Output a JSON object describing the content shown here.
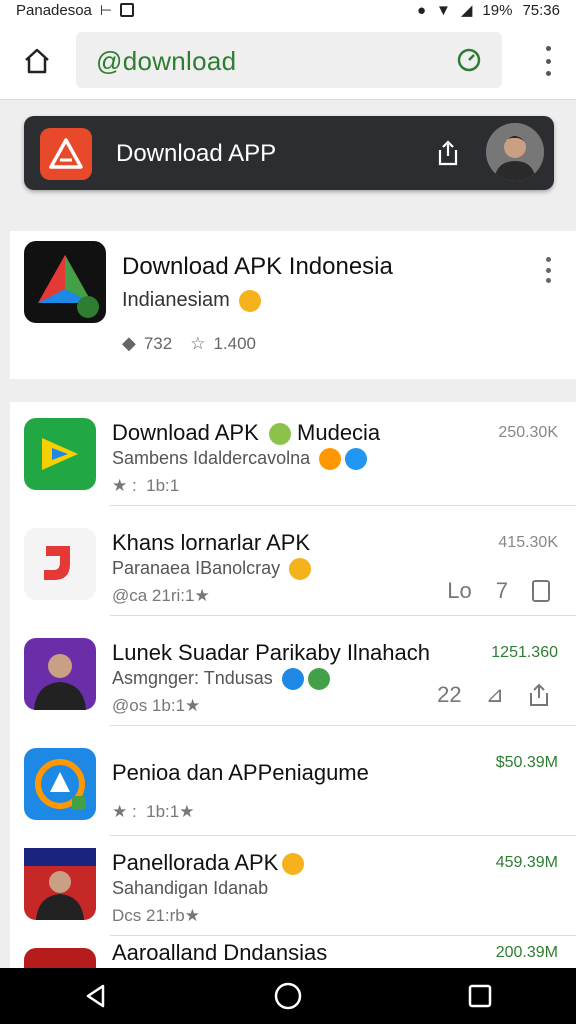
{
  "status_bar": {
    "left_text": "Panadesoa",
    "left_icons": [
      "hash-icon",
      "sim-icon"
    ],
    "battery": "19%",
    "time": "75:36"
  },
  "url_bar": {
    "url": "@download"
  },
  "app_bar": {
    "title": "Download APP"
  },
  "featured": {
    "title": "Download APK Indonesia",
    "subtitle": "Indianesiam",
    "tags_count": "732",
    "rating": "1.400"
  },
  "list": [
    {
      "title": "Download APK",
      "title_suffix": "Mudecia",
      "subtitle": "Sambens Idaldercavolna",
      "meta": "★ :  1b:1",
      "size": "250.30K",
      "size_color": "#888888",
      "actions": []
    },
    {
      "title": "Khans lornarlar APK",
      "subtitle": "Paranaea IBanolcray",
      "meta": "@ca 21ri:1★",
      "size": "415.30K",
      "size_color": "#888888",
      "actions": [
        "Lo",
        "7"
      ]
    },
    {
      "title": "Lunek Suadar Parikaby Ilnahach",
      "subtitle": "Asmgnger: Tndusas",
      "meta": "@os 1b:1★",
      "size": "1251.360",
      "size_color": "#2e7d32",
      "actions": [
        "22"
      ]
    },
    {
      "title": "Penioa dan APPeniagume",
      "subtitle": "",
      "meta": "★ :  1b:1★",
      "size": "$50.39M",
      "size_color": "#2e7d32",
      "actions": []
    },
    {
      "title": "Panellorada APK",
      "subtitle": "Sahandigan Idanab",
      "meta": "Dcs 21:rb★",
      "size": "459.39M",
      "size_color": "#2e7d32",
      "actions": []
    },
    {
      "title": "Aaroalland Dndansias",
      "subtitle": "",
      "meta": "",
      "size": "200.39M",
      "size_color": "#2e7d32",
      "actions": []
    }
  ],
  "colors": {
    "brand_red": "#e8492a",
    "appbar_bg": "#2b2d30",
    "url_green": "#2f7d32"
  }
}
